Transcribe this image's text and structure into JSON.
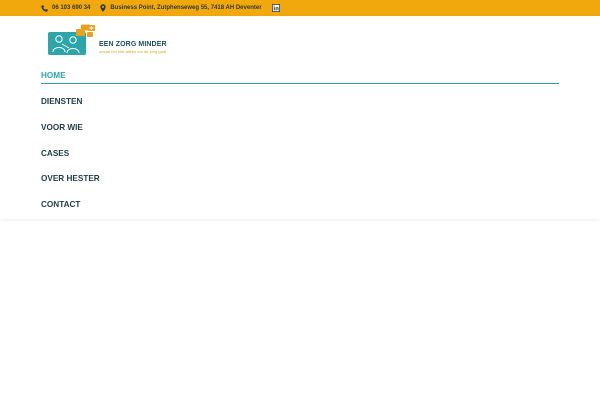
{
  "topbar": {
    "phone": "06 103 690 34",
    "address": "Business Point, Zutphenseweg 55, 7418 AH Deventer",
    "background_color": "#f1a80c",
    "icons": [
      "phone-icon",
      "map-pin-icon",
      "linkedin-icon"
    ]
  },
  "logo": {
    "name": "EEN ZORG MINDER",
    "tagline": "omdat het niet alleen om de zorg gaat",
    "primary_color": "#2ea5a8",
    "accent_color": "#e8a21b"
  },
  "nav": {
    "items": [
      {
        "label": "HOME",
        "active": true
      },
      {
        "label": "DIENSTEN",
        "active": false
      },
      {
        "label": "VOOR WIE",
        "active": false
      },
      {
        "label": "CASES",
        "active": false
      },
      {
        "label": "OVER HESTER",
        "active": false
      },
      {
        "label": "CONTACT",
        "active": false
      }
    ],
    "active_color": "#2ea5a8",
    "text_color": "#1f3d45"
  }
}
